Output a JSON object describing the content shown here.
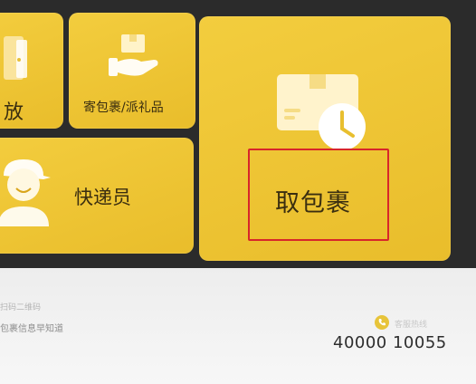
{
  "tiles": {
    "store": {
      "label": "放"
    },
    "send": {
      "label": "寄包裹/派礼品"
    },
    "courier": {
      "label": "快递员"
    },
    "pickup": {
      "label": "取包裹"
    }
  },
  "footer": {
    "hint_qr": "扫码二维码",
    "hint_info": "包裹信息早知道",
    "hotline_label": "客服热线",
    "hotline_number": "40000 10055"
  },
  "colors": {
    "tile": "#f0c93a",
    "highlight": "#d8262a",
    "footer_bg": "#f2f2f2"
  },
  "icons": [
    "door-icon",
    "parcel-hand-icon",
    "courier-avatar-icon",
    "parcel-clock-icon",
    "phone-icon"
  ]
}
